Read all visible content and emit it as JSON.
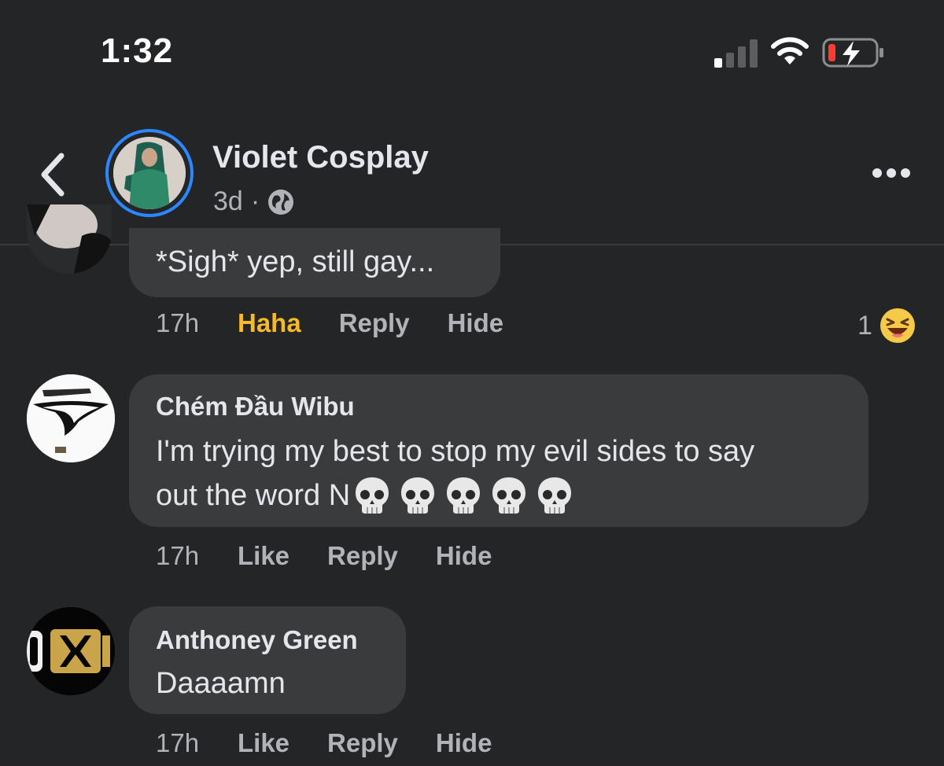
{
  "status_bar": {
    "time": "1:32",
    "battery_state": "low-charging"
  },
  "post": {
    "page_name": "Violet Cosplay",
    "age": "3d",
    "separator": "·",
    "audience_icon": "globe-icon"
  },
  "comments": [
    {
      "text": "*Sigh* yep, still gay...",
      "time": "17h",
      "reaction_label": "Haha",
      "reply_label": "Reply",
      "hide_label": "Hide",
      "reaction_count": "1",
      "reaction_icon": "haha-emoji-icon"
    },
    {
      "author": "Chém Đầu Wibu",
      "line1": "I'm trying my best to stop my evil sides to say",
      "line2": "out the word N",
      "emoji": [
        "skull-emoji-icon",
        "skull-emoji-icon",
        "skull-emoji-icon",
        "skull-emoji-icon",
        "skull-emoji-icon"
      ],
      "time": "17h",
      "like_label": "Like",
      "reply_label": "Reply",
      "hide_label": "Hide"
    },
    {
      "author": "Anthoney Green",
      "text": "Daaaamn",
      "time": "17h",
      "like_label": "Like",
      "reply_label": "Reply",
      "hide_label": "Hide"
    }
  ],
  "colors": {
    "background": "#242526",
    "bubble": "#3a3b3c",
    "text_primary": "#e4e6eb",
    "text_secondary": "#b0b3b8",
    "haha_active": "#f7b928",
    "story_ring": "#2d88ff"
  }
}
